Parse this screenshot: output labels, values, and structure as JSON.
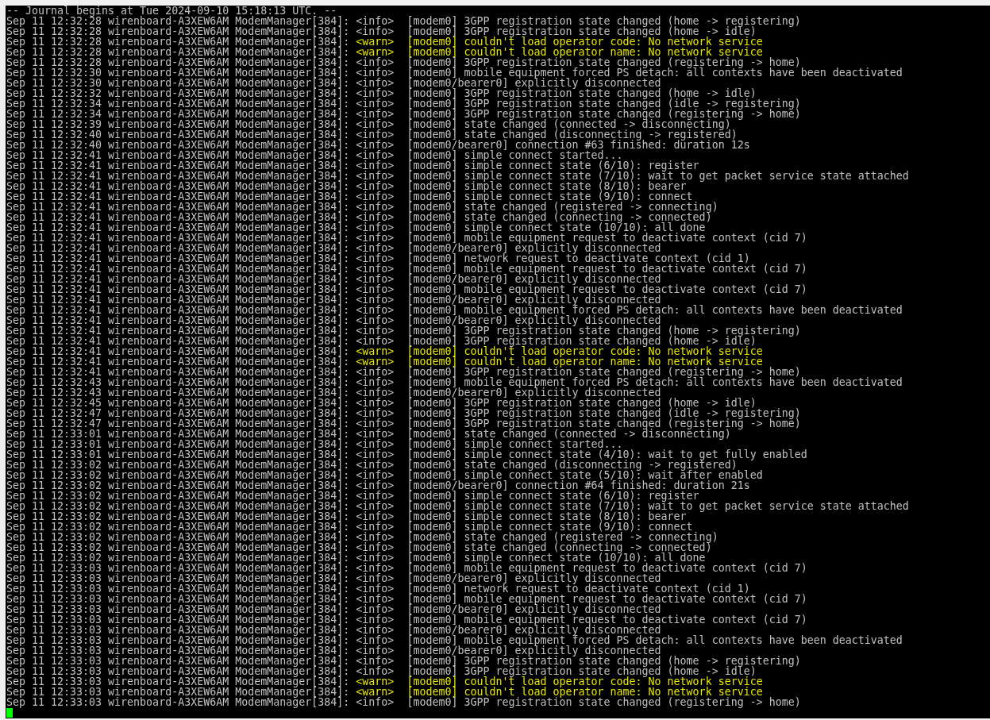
{
  "terminal": {
    "header": "-- Journal begins at Tue 2024-09-10 15:18:13 UTC. --",
    "lines": [
      {
        "kind": "info",
        "prefix": "Sep 11 12:32:28 wirenboard-A3XEW6AM ModemManager[384]:",
        "level": "<info>",
        "message": "[modem0] 3GPP registration state changed (home -> registering)"
      },
      {
        "kind": "info",
        "prefix": "Sep 11 12:32:28 wirenboard-A3XEW6AM ModemManager[384]:",
        "level": "<info>",
        "message": "[modem0] 3GPP registration state changed (home -> idle)"
      },
      {
        "kind": "warn",
        "prefix": "Sep 11 12:32:28 wirenboard-A3XEW6AM ModemManager[384]:",
        "level": "<warn>",
        "message": "[modem0] couldn't load operator code: No network service"
      },
      {
        "kind": "warn",
        "prefix": "Sep 11 12:32:28 wirenboard-A3XEW6AM ModemManager[384]:",
        "level": "<warn>",
        "message": "[modem0] couldn't load operator name: No network service"
      },
      {
        "kind": "info",
        "prefix": "Sep 11 12:32:28 wirenboard-A3XEW6AM ModemManager[384]:",
        "level": "<info>",
        "message": "[modem0] 3GPP registration state changed (registering -> home)"
      },
      {
        "kind": "info",
        "prefix": "Sep 11 12:32:30 wirenboard-A3XEW6AM ModemManager[384]:",
        "level": "<info>",
        "message": "[modem0] mobile equipment forced PS detach: all contexts have been deactivated"
      },
      {
        "kind": "info",
        "prefix": "Sep 11 12:32:30 wirenboard-A3XEW6AM ModemManager[384]:",
        "level": "<info>",
        "message": "[modem0/bearer0] explicitly disconnected"
      },
      {
        "kind": "info",
        "prefix": "Sep 11 12:32:32 wirenboard-A3XEW6AM ModemManager[384]:",
        "level": "<info>",
        "message": "[modem0] 3GPP registration state changed (home -> idle)"
      },
      {
        "kind": "info",
        "prefix": "Sep 11 12:32:34 wirenboard-A3XEW6AM ModemManager[384]:",
        "level": "<info>",
        "message": "[modem0] 3GPP registration state changed (idle -> registering)"
      },
      {
        "kind": "info",
        "prefix": "Sep 11 12:32:34 wirenboard-A3XEW6AM ModemManager[384]:",
        "level": "<info>",
        "message": "[modem0] 3GPP registration state changed (registering -> home)"
      },
      {
        "kind": "info",
        "prefix": "Sep 11 12:32:39 wirenboard-A3XEW6AM ModemManager[384]:",
        "level": "<info>",
        "message": "[modem0] state changed (connected -> disconnecting)"
      },
      {
        "kind": "info",
        "prefix": "Sep 11 12:32:40 wirenboard-A3XEW6AM ModemManager[384]:",
        "level": "<info>",
        "message": "[modem0] state changed (disconnecting -> registered)"
      },
      {
        "kind": "info",
        "prefix": "Sep 11 12:32:40 wirenboard-A3XEW6AM ModemManager[384]:",
        "level": "<info>",
        "message": "[modem0/bearer0] connection #63 finished: duration 12s"
      },
      {
        "kind": "info",
        "prefix": "Sep 11 12:32:41 wirenboard-A3XEW6AM ModemManager[384]:",
        "level": "<info>",
        "message": "[modem0] simple connect started..."
      },
      {
        "kind": "info",
        "prefix": "Sep 11 12:32:41 wirenboard-A3XEW6AM ModemManager[384]:",
        "level": "<info>",
        "message": "[modem0] simple connect state (6/10): register"
      },
      {
        "kind": "info",
        "prefix": "Sep 11 12:32:41 wirenboard-A3XEW6AM ModemManager[384]:",
        "level": "<info>",
        "message": "[modem0] simple connect state (7/10): wait to get packet service state attached"
      },
      {
        "kind": "info",
        "prefix": "Sep 11 12:32:41 wirenboard-A3XEW6AM ModemManager[384]:",
        "level": "<info>",
        "message": "[modem0] simple connect state (8/10): bearer"
      },
      {
        "kind": "info",
        "prefix": "Sep 11 12:32:41 wirenboard-A3XEW6AM ModemManager[384]:",
        "level": "<info>",
        "message": "[modem0] simple connect state (9/10): connect"
      },
      {
        "kind": "info",
        "prefix": "Sep 11 12:32:41 wirenboard-A3XEW6AM ModemManager[384]:",
        "level": "<info>",
        "message": "[modem0] state changed (registered -> connecting)"
      },
      {
        "kind": "info",
        "prefix": "Sep 11 12:32:41 wirenboard-A3XEW6AM ModemManager[384]:",
        "level": "<info>",
        "message": "[modem0] state changed (connecting -> connected)"
      },
      {
        "kind": "info",
        "prefix": "Sep 11 12:32:41 wirenboard-A3XEW6AM ModemManager[384]:",
        "level": "<info>",
        "message": "[modem0] simple connect state (10/10): all done"
      },
      {
        "kind": "info",
        "prefix": "Sep 11 12:32:41 wirenboard-A3XEW6AM ModemManager[384]:",
        "level": "<info>",
        "message": "[modem0] mobile equipment request to deactivate context (cid 7)"
      },
      {
        "kind": "info",
        "prefix": "Sep 11 12:32:41 wirenboard-A3XEW6AM ModemManager[384]:",
        "level": "<info>",
        "message": "[modem0/bearer0] explicitly disconnected"
      },
      {
        "kind": "info",
        "prefix": "Sep 11 12:32:41 wirenboard-A3XEW6AM ModemManager[384]:",
        "level": "<info>",
        "message": "[modem0] network request to deactivate context (cid 1)"
      },
      {
        "kind": "info",
        "prefix": "Sep 11 12:32:41 wirenboard-A3XEW6AM ModemManager[384]:",
        "level": "<info>",
        "message": "[modem0] mobile equipment request to deactivate context (cid 7)"
      },
      {
        "kind": "info",
        "prefix": "Sep 11 12:32:41 wirenboard-A3XEW6AM ModemManager[384]:",
        "level": "<info>",
        "message": "[modem0/bearer0] explicitly disconnected"
      },
      {
        "kind": "info",
        "prefix": "Sep 11 12:32:41 wirenboard-A3XEW6AM ModemManager[384]:",
        "level": "<info>",
        "message": "[modem0] mobile equipment request to deactivate context (cid 7)"
      },
      {
        "kind": "info",
        "prefix": "Sep 11 12:32:41 wirenboard-A3XEW6AM ModemManager[384]:",
        "level": "<info>",
        "message": "[modem0/bearer0] explicitly disconnected"
      },
      {
        "kind": "info",
        "prefix": "Sep 11 12:32:41 wirenboard-A3XEW6AM ModemManager[384]:",
        "level": "<info>",
        "message": "[modem0] mobile equipment forced PS detach: all contexts have been deactivated"
      },
      {
        "kind": "info",
        "prefix": "Sep 11 12:32:41 wirenboard-A3XEW6AM ModemManager[384]:",
        "level": "<info>",
        "message": "[modem0/bearer0] explicitly disconnected"
      },
      {
        "kind": "info",
        "prefix": "Sep 11 12:32:41 wirenboard-A3XEW6AM ModemManager[384]:",
        "level": "<info>",
        "message": "[modem0] 3GPP registration state changed (home -> registering)"
      },
      {
        "kind": "info",
        "prefix": "Sep 11 12:32:41 wirenboard-A3XEW6AM ModemManager[384]:",
        "level": "<info>",
        "message": "[modem0] 3GPP registration state changed (home -> idle)"
      },
      {
        "kind": "warn",
        "prefix": "Sep 11 12:32:41 wirenboard-A3XEW6AM ModemManager[384]:",
        "level": "<warn>",
        "message": "[modem0] couldn't load operator code: No network service"
      },
      {
        "kind": "warn",
        "prefix": "Sep 11 12:32:41 wirenboard-A3XEW6AM ModemManager[384]:",
        "level": "<warn>",
        "message": "[modem0] couldn't load operator name: No network service"
      },
      {
        "kind": "info",
        "prefix": "Sep 11 12:32:41 wirenboard-A3XEW6AM ModemManager[384]:",
        "level": "<info>",
        "message": "[modem0] 3GPP registration state changed (registering -> home)"
      },
      {
        "kind": "info",
        "prefix": "Sep 11 12:32:43 wirenboard-A3XEW6AM ModemManager[384]:",
        "level": "<info>",
        "message": "[modem0] mobile equipment forced PS detach: all contexts have been deactivated"
      },
      {
        "kind": "info",
        "prefix": "Sep 11 12:32:43 wirenboard-A3XEW6AM ModemManager[384]:",
        "level": "<info>",
        "message": "[modem0/bearer0] explicitly disconnected"
      },
      {
        "kind": "info",
        "prefix": "Sep 11 12:32:45 wirenboard-A3XEW6AM ModemManager[384]:",
        "level": "<info>",
        "message": "[modem0] 3GPP registration state changed (home -> idle)"
      },
      {
        "kind": "info",
        "prefix": "Sep 11 12:32:47 wirenboard-A3XEW6AM ModemManager[384]:",
        "level": "<info>",
        "message": "[modem0] 3GPP registration state changed (idle -> registering)"
      },
      {
        "kind": "info",
        "prefix": "Sep 11 12:32:47 wirenboard-A3XEW6AM ModemManager[384]:",
        "level": "<info>",
        "message": "[modem0] 3GPP registration state changed (registering -> home)"
      },
      {
        "kind": "info",
        "prefix": "Sep 11 12:33:01 wirenboard-A3XEW6AM ModemManager[384]:",
        "level": "<info>",
        "message": "[modem0] state changed (connected -> disconnecting)"
      },
      {
        "kind": "info",
        "prefix": "Sep 11 12:33:01 wirenboard-A3XEW6AM ModemManager[384]:",
        "level": "<info>",
        "message": "[modem0] simple connect started..."
      },
      {
        "kind": "info",
        "prefix": "Sep 11 12:33:01 wirenboard-A3XEW6AM ModemManager[384]:",
        "level": "<info>",
        "message": "[modem0] simple connect state (4/10): wait to get fully enabled"
      },
      {
        "kind": "info",
        "prefix": "Sep 11 12:33:02 wirenboard-A3XEW6AM ModemManager[384]:",
        "level": "<info>",
        "message": "[modem0] state changed (disconnecting -> registered)"
      },
      {
        "kind": "info",
        "prefix": "Sep 11 12:33:02 wirenboard-A3XEW6AM ModemManager[384]:",
        "level": "<info>",
        "message": "[modem0] simple connect state (5/10): wait after enabled"
      },
      {
        "kind": "info",
        "prefix": "Sep 11 12:33:02 wirenboard-A3XEW6AM ModemManager[384]:",
        "level": "<info>",
        "message": "[modem0/bearer0] connection #64 finished: duration 21s"
      },
      {
        "kind": "info",
        "prefix": "Sep 11 12:33:02 wirenboard-A3XEW6AM ModemManager[384]:",
        "level": "<info>",
        "message": "[modem0] simple connect state (6/10): register"
      },
      {
        "kind": "info",
        "prefix": "Sep 11 12:33:02 wirenboard-A3XEW6AM ModemManager[384]:",
        "level": "<info>",
        "message": "[modem0] simple connect state (7/10): wait to get packet service state attached"
      },
      {
        "kind": "info",
        "prefix": "Sep 11 12:33:02 wirenboard-A3XEW6AM ModemManager[384]:",
        "level": "<info>",
        "message": "[modem0] simple connect state (8/10): bearer"
      },
      {
        "kind": "info",
        "prefix": "Sep 11 12:33:02 wirenboard-A3XEW6AM ModemManager[384]:",
        "level": "<info>",
        "message": "[modem0] simple connect state (9/10): connect"
      },
      {
        "kind": "info",
        "prefix": "Sep 11 12:33:02 wirenboard-A3XEW6AM ModemManager[384]:",
        "level": "<info>",
        "message": "[modem0] state changed (registered -> connecting)"
      },
      {
        "kind": "info",
        "prefix": "Sep 11 12:33:02 wirenboard-A3XEW6AM ModemManager[384]:",
        "level": "<info>",
        "message": "[modem0] state changed (connecting -> connected)"
      },
      {
        "kind": "info",
        "prefix": "Sep 11 12:33:02 wirenboard-A3XEW6AM ModemManager[384]:",
        "level": "<info>",
        "message": "[modem0] simple connect state (10/10): all done"
      },
      {
        "kind": "info",
        "prefix": "Sep 11 12:33:03 wirenboard-A3XEW6AM ModemManager[384]:",
        "level": "<info>",
        "message": "[modem0] mobile equipment request to deactivate context (cid 7)"
      },
      {
        "kind": "info",
        "prefix": "Sep 11 12:33:03 wirenboard-A3XEW6AM ModemManager[384]:",
        "level": "<info>",
        "message": "[modem0/bearer0] explicitly disconnected"
      },
      {
        "kind": "info",
        "prefix": "Sep 11 12:33:03 wirenboard-A3XEW6AM ModemManager[384]:",
        "level": "<info>",
        "message": "[modem0] network request to deactivate context (cid 1)"
      },
      {
        "kind": "info",
        "prefix": "Sep 11 12:33:03 wirenboard-A3XEW6AM ModemManager[384]:",
        "level": "<info>",
        "message": "[modem0] mobile equipment request to deactivate context (cid 7)"
      },
      {
        "kind": "info",
        "prefix": "Sep 11 12:33:03 wirenboard-A3XEW6AM ModemManager[384]:",
        "level": "<info>",
        "message": "[modem0/bearer0] explicitly disconnected"
      },
      {
        "kind": "info",
        "prefix": "Sep 11 12:33:03 wirenboard-A3XEW6AM ModemManager[384]:",
        "level": "<info>",
        "message": "[modem0] mobile equipment request to deactivate context (cid 7)"
      },
      {
        "kind": "info",
        "prefix": "Sep 11 12:33:03 wirenboard-A3XEW6AM ModemManager[384]:",
        "level": "<info>",
        "message": "[modem0/bearer0] explicitly disconnected"
      },
      {
        "kind": "info",
        "prefix": "Sep 11 12:33:03 wirenboard-A3XEW6AM ModemManager[384]:",
        "level": "<info>",
        "message": "[modem0] mobile equipment forced PS detach: all contexts have been deactivated"
      },
      {
        "kind": "info",
        "prefix": "Sep 11 12:33:03 wirenboard-A3XEW6AM ModemManager[384]:",
        "level": "<info>",
        "message": "[modem0/bearer0] explicitly disconnected"
      },
      {
        "kind": "info",
        "prefix": "Sep 11 12:33:03 wirenboard-A3XEW6AM ModemManager[384]:",
        "level": "<info>",
        "message": "[modem0] 3GPP registration state changed (home -> registering)"
      },
      {
        "kind": "info",
        "prefix": "Sep 11 12:33:03 wirenboard-A3XEW6AM ModemManager[384]:",
        "level": "<info>",
        "message": "[modem0] 3GPP registration state changed (home -> idle)"
      },
      {
        "kind": "warn",
        "prefix": "Sep 11 12:33:03 wirenboard-A3XEW6AM ModemManager[384]:",
        "level": "<warn>",
        "message": "[modem0] couldn't load operator code: No network service"
      },
      {
        "kind": "warn",
        "prefix": "Sep 11 12:33:03 wirenboard-A3XEW6AM ModemManager[384]:",
        "level": "<warn>",
        "message": "[modem0] couldn't load operator name: No network service"
      },
      {
        "kind": "info",
        "prefix": "Sep 11 12:33:03 wirenboard-A3XEW6AM ModemManager[384]:",
        "level": "<info>",
        "message": "[modem0] 3GPP registration state changed (registering -> home)"
      }
    ]
  }
}
